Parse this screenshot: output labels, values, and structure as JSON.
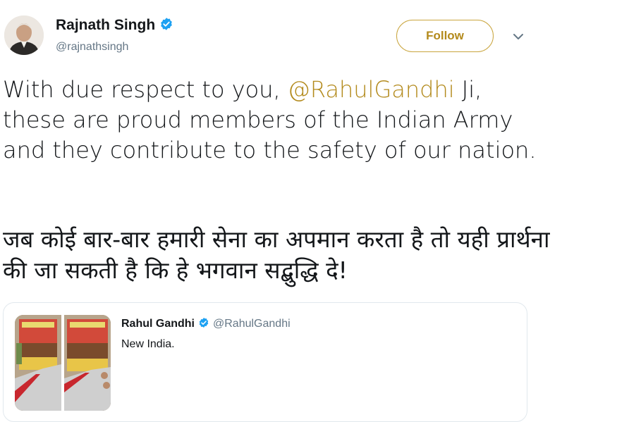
{
  "author": {
    "name": "Rajnath Singh",
    "handle": "@rajnathsingh",
    "verified": true
  },
  "follow_button": {
    "label": "Follow"
  },
  "tweet": {
    "text_before": "With due respect to you, ",
    "mention": "@RahulGandhi",
    "text_after": " Ji, these are proud members of the Indian Army and they contribute to the safety of our nation.",
    "hindi_text": "जब कोई बार-बार हमारी सेना का अपमान करता है तो यही प्रार्थना की जा सकती है कि हे भगवान सद्बुद्धि दे!"
  },
  "quoted_tweet": {
    "name": "Rahul Gandhi",
    "handle": "@RahulGandhi",
    "verified": true,
    "text": "New India."
  },
  "colors": {
    "accent": "#b38a1c",
    "verified": "#1da1f2",
    "text": "#14171a",
    "secondary": "#657786"
  },
  "icons": [
    "verified-badge-icon",
    "chevron-down-icon"
  ]
}
